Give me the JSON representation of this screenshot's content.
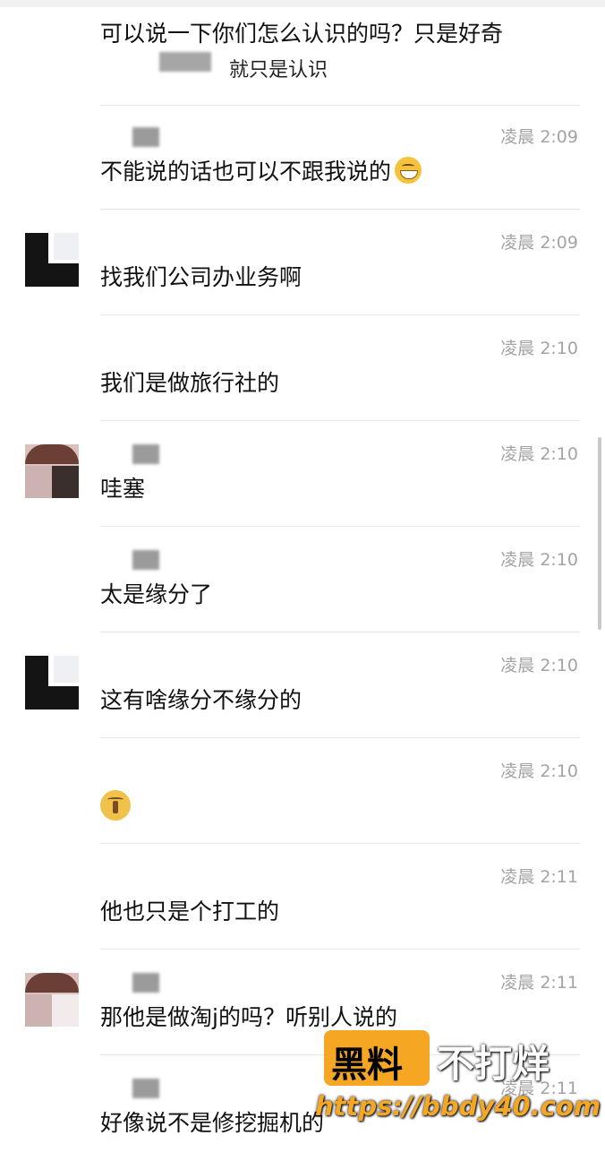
{
  "messages": [
    {
      "time": "",
      "text": "可以说一下你们怎么认识的吗？只是好奇",
      "sub": "就只是认识"
    },
    {
      "time": "凌晨 2:09",
      "text": "不能说的话也可以不跟我说的",
      "emoji": "grinning-face-icon"
    },
    {
      "time": "凌晨 2:09",
      "text": "找我们公司办业务啊"
    },
    {
      "time": "凌晨 2:10",
      "text": "我们是做旅行社的"
    },
    {
      "time": "凌晨 2:10",
      "text": "哇塞"
    },
    {
      "time": "凌晨 2:10",
      "text": "太是缘分了"
    },
    {
      "time": "凌晨 2:10",
      "text": "这有啥缘分不缘分的"
    },
    {
      "time": "凌晨 2:10",
      "text": "",
      "emoji": "zipper-mouth-face-icon"
    },
    {
      "time": "凌晨 2:11",
      "text": "他也只是个打工的"
    },
    {
      "time": "凌晨 2:11",
      "text": "那他是做淘j的吗？听别人说的"
    },
    {
      "time": "凌晨 2:11",
      "text": "好像说不是修挖掘机的"
    }
  ],
  "watermark": {
    "box": "黑料",
    "side": "不打烊",
    "url": "https://bbdy40.com"
  }
}
